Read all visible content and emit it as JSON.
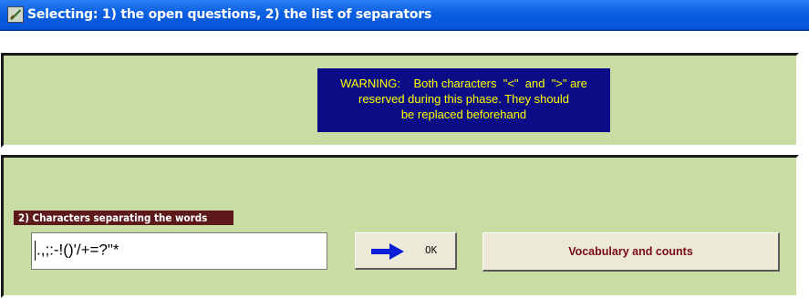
{
  "window": {
    "title": "Selecting: 1)  the open questions, 2) the list of separators",
    "icon": "app-icon"
  },
  "warning": {
    "lines": [
      "WARNING:    Both characters  \"<\"  and  \">\" are",
      "reserved during this phase. They should",
      "be replaced beforehand"
    ]
  },
  "separators": {
    "label": "2)   Characters separating the words",
    "value": ".,;:-!()'/+=?\"*"
  },
  "buttons": {
    "ok_label": "OK",
    "vocab_label": "Vocabulary and counts"
  },
  "colors": {
    "panel": "#c9dca3",
    "warning_bg": "#0c0c86",
    "warning_text": "#ffff00",
    "label_bg": "#5e1a1a",
    "vocab_text": "#7a0a14",
    "arrow": "#0a1fd6"
  }
}
